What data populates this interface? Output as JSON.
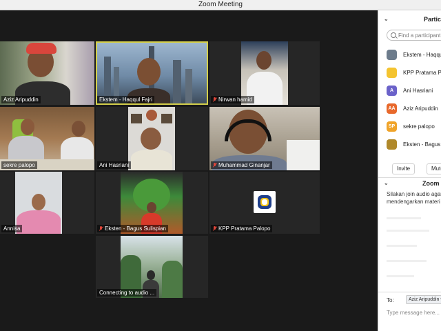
{
  "window": {
    "title": "Zoom Meeting"
  },
  "tiles": [
    {
      "name": "Aziz Aripuddin",
      "muted": false,
      "active": false
    },
    {
      "name": "Ekstem - Haqqul Fajri",
      "muted": false,
      "active": true
    },
    {
      "name": "Nirwan hamid",
      "muted": true,
      "active": false
    },
    {
      "name": "sekre palopo",
      "muted": false,
      "active": false
    },
    {
      "name": "Ani Hasriani",
      "muted": false,
      "active": false
    },
    {
      "name": "Muhammad Ginanjar",
      "muted": true,
      "active": false
    },
    {
      "name": "Annisa",
      "muted": false,
      "active": false
    },
    {
      "name": "Eksten - Bagus Sulispian",
      "muted": true,
      "active": false
    },
    {
      "name": "KPP Pratama Palopo",
      "muted": true,
      "active": false
    },
    {
      "name": "Connecting to audio ...",
      "muted": false,
      "active": false
    }
  ],
  "panel": {
    "participants": {
      "header": "Participants",
      "search_placeholder": "Find a participant",
      "items": [
        {
          "name": "Ekstem - Haqqul Fajri",
          "avatar": "",
          "color": "#6d7c8c"
        },
        {
          "name": "KPP Pratama Palopo",
          "avatar": "",
          "color": "#f4c430"
        },
        {
          "name": "Ani Hasriani",
          "avatar": "A",
          "color": "#6b62c9"
        },
        {
          "name": "Aziz Aripuddin",
          "avatar": "AA",
          "color": "#e8692c"
        },
        {
          "name": "sekre palopo",
          "avatar": "SP",
          "color": "#f0a42a"
        },
        {
          "name": "Eksten - Bagus Sulispian",
          "avatar": "",
          "color": "#b0892a"
        }
      ],
      "invite_label": "Invite",
      "mute_label": "Mute All"
    },
    "chat": {
      "header": "Zoom Group Chat",
      "message_line1": "Silakan join audio agar",
      "message_line2": "mendengarkan materi",
      "to_label": "To:",
      "to_value": "Aziz Aripuddin",
      "input_placeholder": "Type message here..."
    }
  }
}
